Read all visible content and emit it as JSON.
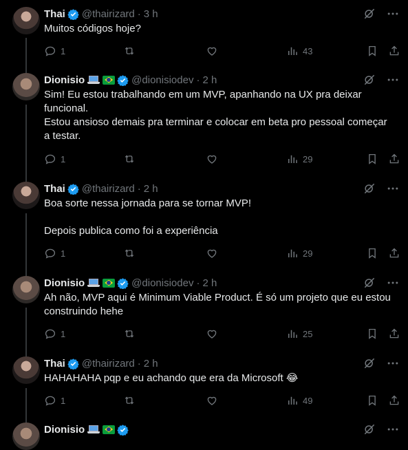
{
  "tweets": [
    {
      "author": "Thai",
      "handle": "@thairizard",
      "time": "3 h",
      "avatar": "thai",
      "text": "Muitos códigos hoje?",
      "replies": "1",
      "views": "43",
      "emojis": []
    },
    {
      "author": "Dionisio",
      "handle": "@dionisiodev",
      "time": "2 h",
      "avatar": "dio",
      "text": "Sim! Eu estou trabalhando em um MVP, apanhando na UX pra deixar\nfuncional.\nEstou ansioso demais pra terminar e colocar em beta pro pessoal começar\na testar.",
      "replies": "1",
      "views": "29",
      "emojis": [
        "laptop",
        "flag"
      ]
    },
    {
      "author": "Thai",
      "handle": "@thairizard",
      "time": "2 h",
      "avatar": "thai",
      "text": "Boa sorte nessa jornada para se tornar MVP!\n\nDepois publica como foi a experiência",
      "replies": "1",
      "views": "29",
      "emojis": []
    },
    {
      "author": "Dionisio",
      "handle": "@dionisiodev",
      "time": "2 h",
      "avatar": "dio",
      "text": "Ah não, MVP aqui é Minimum Viable Product. É só um projeto que eu estou\nconstruindo hehe",
      "replies": "1",
      "views": "25",
      "emojis": [
        "laptop",
        "flag"
      ]
    },
    {
      "author": "Thai",
      "handle": "@thairizard",
      "time": "2 h",
      "avatar": "thai",
      "text": "HAHAHAHA pqp e eu achando que era da Microsoft 😂",
      "replies": "1",
      "views": "49",
      "emojis": []
    },
    {
      "author": "Dionisio",
      "handle": "",
      "time": "",
      "avatar": "dio",
      "text": "",
      "replies": "",
      "views": "",
      "emojis": [
        "laptop",
        "flag"
      ]
    }
  ],
  "colors": {
    "background": "#000000",
    "text": "#e7e9ea",
    "muted": "#71767b",
    "verified": "#1d9bf0",
    "line": "#333639"
  },
  "icons": [
    "grok-icon",
    "more-icon",
    "reply-icon",
    "retweet-icon",
    "like-icon",
    "views-icon",
    "bookmark-icon",
    "share-icon",
    "verified-icon"
  ]
}
